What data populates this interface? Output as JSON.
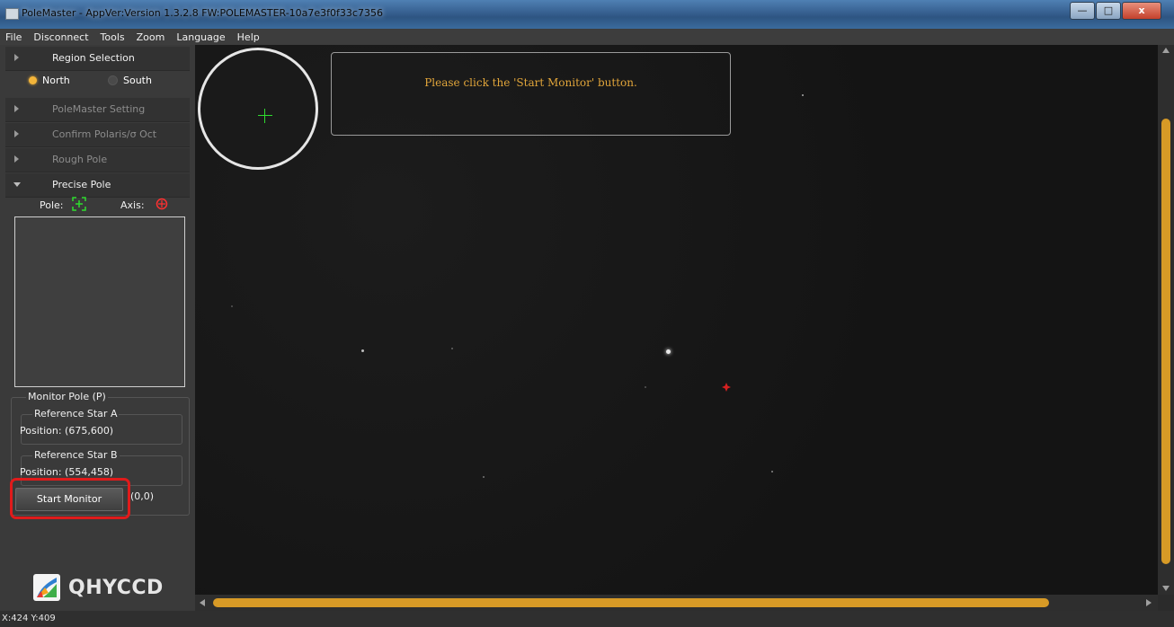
{
  "window": {
    "title": "PoleMaster - AppVer:Version 1.3.2.8 FW:POLEMASTER-10a7e3f0f33c7356",
    "minimize_label": "—",
    "maximize_label": "□",
    "close_label": "x"
  },
  "menu": [
    "File",
    "Disconnect",
    "Tools",
    "Zoom",
    "Language",
    "Help"
  ],
  "sidebar": {
    "region_selection": "Region Selection",
    "north": "North",
    "south": "South",
    "selected_region": "North",
    "polemaster_setting": "PoleMaster Setting",
    "confirm_polaris": "Confirm Polaris/σ Oct",
    "rough_pole": "Rough Pole",
    "precise_pole": "Precise Pole",
    "pole_label": "Pole:",
    "axis_label": "Axis:",
    "monitor_pole": "Monitor Pole (P)",
    "ref_star_a": {
      "title": "Reference Star A",
      "position": "Position: (675,600)"
    },
    "ref_star_b": {
      "title": "Reference Star B",
      "position": "Position: (554,458)"
    },
    "start_monitor": "Start Monitor",
    "offset": "(0,0)",
    "logo_text": "QHYCCD"
  },
  "viewer": {
    "message": "Please click the 'Start Monitor' button."
  },
  "status": {
    "coords": "X:424 Y:409"
  },
  "colors": {
    "accent": "#d79a26",
    "message": "#e1a53a",
    "highlight": "#e01b1b",
    "pole_green": "#2edc2e"
  }
}
